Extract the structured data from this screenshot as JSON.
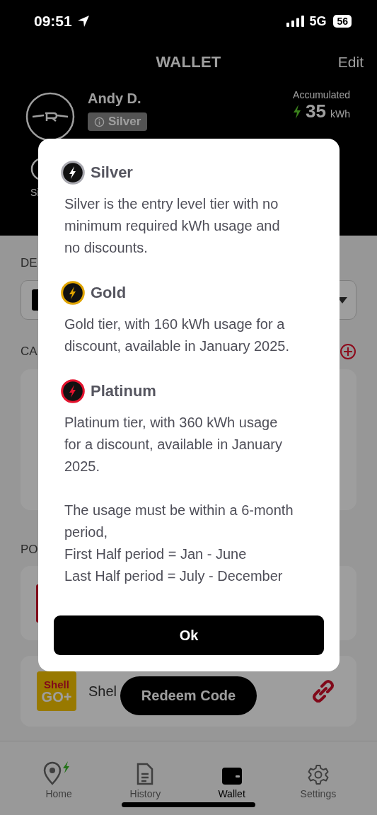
{
  "status_bar": {
    "time": "09:51",
    "network": "5G",
    "battery": "56"
  },
  "header": {
    "title": "WALLET",
    "action": "Edit"
  },
  "profile": {
    "name": "Andy D.",
    "tier": "Silver",
    "accumulated_label": "Accumulated",
    "accumulated_value": "35",
    "accumulated_unit": "kWh",
    "stat_fragment": "Si"
  },
  "sections": [
    {
      "label": "DE",
      "kind": "dropdown"
    },
    {
      "label": "CA",
      "kind": "cards"
    },
    {
      "label": "PO",
      "kind": "partners"
    }
  ],
  "partner": {
    "logo_lines": [
      "Shell",
      "GO+"
    ],
    "name": "Shel"
  },
  "redeem_button": "Redeem Code",
  "tabs": [
    {
      "label": "Home",
      "kind": "home",
      "selected": false
    },
    {
      "label": "History",
      "kind": "history",
      "selected": false
    },
    {
      "label": "Wallet",
      "kind": "wallet",
      "selected": true
    },
    {
      "label": "Settings",
      "kind": "settings",
      "selected": false
    }
  ],
  "dialog": {
    "tiers": [
      {
        "name": "Silver",
        "color": "#a9a9b0",
        "description": "Silver is the entry level tier with no minimum required kWh usage and no discounts."
      },
      {
        "name": "Gold",
        "color": "#e0a400",
        "description": "Gold tier, with 160 kWh usage for a discount, available in January 2025."
      },
      {
        "name": "Platinum",
        "color": "#e4132e",
        "description": "Platinum tier, with 360 kWh usage for a discount, available in January 2025."
      }
    ],
    "note_lines": [
      "The usage must be within a 6-month period,",
      "First Half period = Jan - June",
      "Last Half period = July - December"
    ],
    "button": "Ok"
  }
}
